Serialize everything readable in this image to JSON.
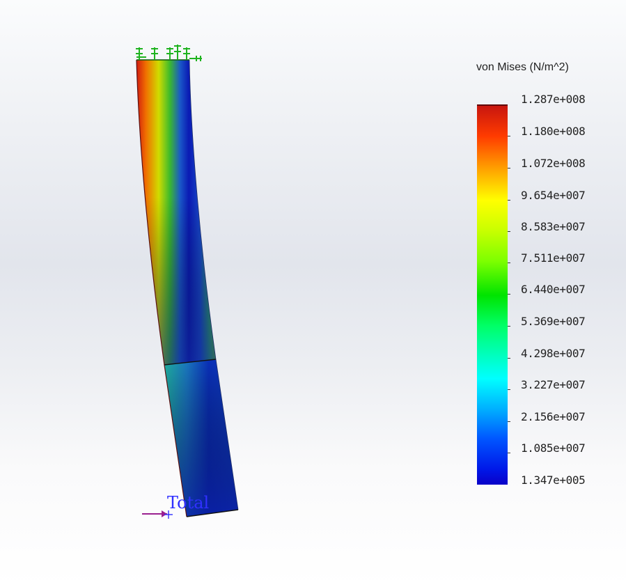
{
  "legend": {
    "title": "von Mises (N/m^2)",
    "labels": [
      "1.287e+008",
      "1.180e+008",
      "1.072e+008",
      "9.654e+007",
      "8.583e+007",
      "7.511e+007",
      "6.440e+007",
      "5.369e+007",
      "4.298e+007",
      "3.227e+007",
      "2.156e+007",
      "1.085e+007",
      "1.347e+005"
    ]
  },
  "load_label": "Total",
  "colors": {
    "fixture": "#1fb31f",
    "load_arrow": "#9a2090",
    "load_text": "#3030ff"
  }
}
